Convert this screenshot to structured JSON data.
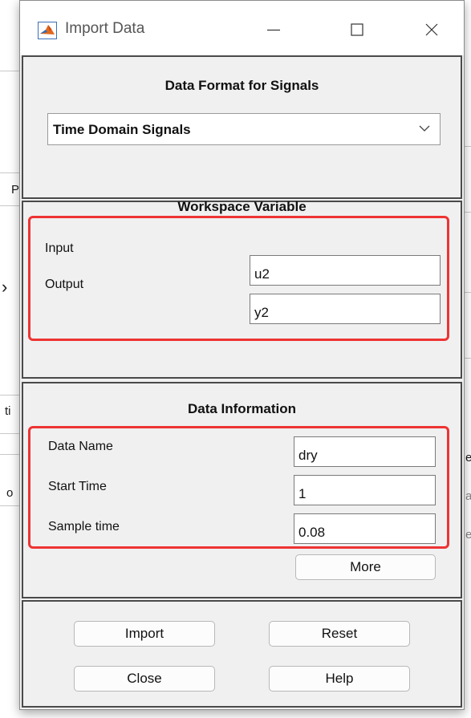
{
  "window": {
    "title": "Import Data",
    "controls": {
      "minimize": "minimize-icon",
      "maximize": "maximize-icon",
      "close": "close-icon"
    }
  },
  "data_format": {
    "title": "Data Format for Signals",
    "selected": "Time Domain Signals"
  },
  "workspace": {
    "title": "Workspace Variable",
    "input_label": "Input",
    "input_value": "u2",
    "output_label": "Output",
    "output_value": "y2"
  },
  "info": {
    "title": "Data Information",
    "name_label": "Data Name",
    "name_value": "dry",
    "start_label": "Start Time",
    "start_value": "1",
    "sample_label": "Sample time",
    "sample_value": "0.08",
    "more_label": "More"
  },
  "actions": {
    "import_label": "Import",
    "reset_label": "Reset",
    "close_label": "Close",
    "help_label": "Help"
  },
  "background": {
    "frag_p": "P",
    "frag_arrow": "›",
    "frag_ti": "ti",
    "frag_o": "o",
    "frag_e": "e",
    "frag_a": "a",
    "frag_e2": "e"
  },
  "colors": {
    "highlight": "#ee3333",
    "panel_bg": "#f0f0f0",
    "panel_border": "#4a4a4a"
  }
}
